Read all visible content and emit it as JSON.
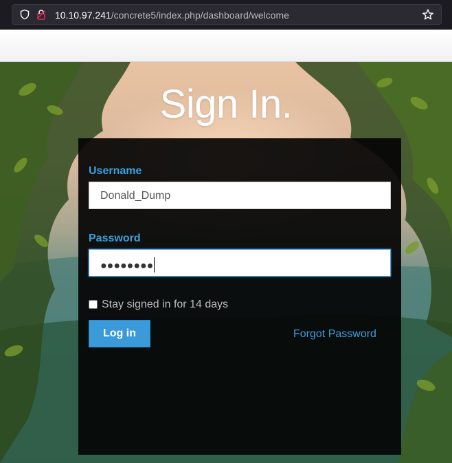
{
  "browser": {
    "url_host": "10.10.97.241",
    "url_path": "/concrete5/index.php/dashboard/welcome",
    "icons": [
      "shield-icon",
      "lock-icon",
      "star-icon"
    ]
  },
  "page": {
    "title": "Sign In."
  },
  "form": {
    "username_label": "Username",
    "username_value": "Donald_Dump",
    "password_label": "Password",
    "password_mask": "●●●●●●●●",
    "remember_label": "Stay signed in for 14 days",
    "remember_checked": false,
    "login_label": "Log in",
    "forgot_label": "Forgot Password"
  },
  "colors": {
    "accent": "#3aa0de",
    "button": "#3b9ad9",
    "panel": "#050505"
  }
}
